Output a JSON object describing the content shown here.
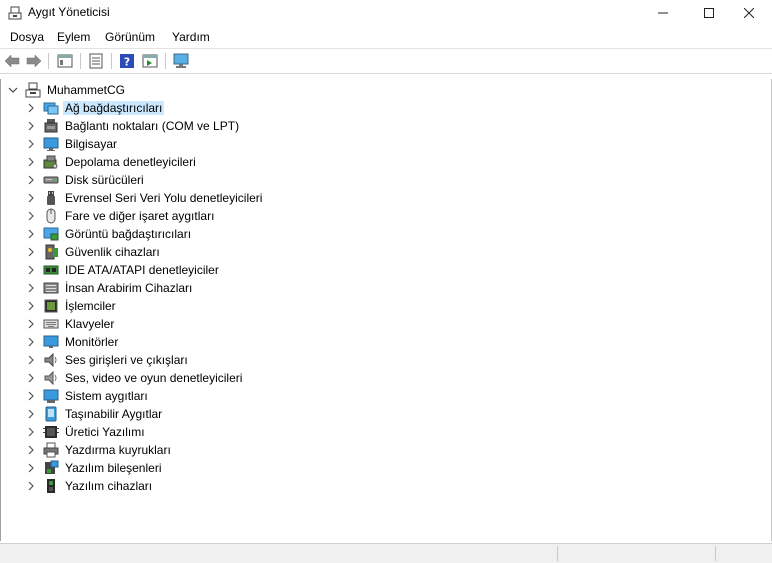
{
  "window": {
    "title": "Aygıt Yöneticisi"
  },
  "menu": [
    "Dosya",
    "Eylem",
    "Görünüm",
    "Yardım"
  ],
  "tree": {
    "root": "MuhammetCG",
    "items": [
      {
        "label": "Ağ bağdaştırıcıları",
        "icon": "network-adapter-icon",
        "selected": true
      },
      {
        "label": "Bağlantı noktaları (COM ve LPT)",
        "icon": "port-icon"
      },
      {
        "label": "Bilgisayar",
        "icon": "computer-icon"
      },
      {
        "label": "Depolama denetleyicileri",
        "icon": "storage-controller-icon"
      },
      {
        "label": "Disk sürücüleri",
        "icon": "disk-drive-icon"
      },
      {
        "label": "Evrensel Seri Veri Yolu denetleyicileri",
        "icon": "usb-icon"
      },
      {
        "label": "Fare ve diğer işaret aygıtları",
        "icon": "mouse-icon"
      },
      {
        "label": "Görüntü bağdaştırıcıları",
        "icon": "display-adapter-icon"
      },
      {
        "label": "Güvenlik cihazları",
        "icon": "security-device-icon"
      },
      {
        "label": "IDE ATA/ATAPI denetleyiciler",
        "icon": "ide-controller-icon"
      },
      {
        "label": "İnsan Arabirim Cihazları",
        "icon": "hid-icon"
      },
      {
        "label": "İşlemciler",
        "icon": "processor-icon"
      },
      {
        "label": "Klavyeler",
        "icon": "keyboard-icon"
      },
      {
        "label": "Monitörler",
        "icon": "monitor-icon"
      },
      {
        "label": "Ses girişleri ve çıkışları",
        "icon": "speaker-icon"
      },
      {
        "label": "Ses, video ve oyun denetleyicileri",
        "icon": "sound-icon"
      },
      {
        "label": "Sistem aygıtları",
        "icon": "system-device-icon"
      },
      {
        "label": "Taşınabilir Aygıtlar",
        "icon": "portable-device-icon"
      },
      {
        "label": "Üretici Yazılımı",
        "icon": "firmware-icon"
      },
      {
        "label": "Yazdırma kuyrukları",
        "icon": "printer-icon"
      },
      {
        "label": "Yazılım bileşenleri",
        "icon": "software-component-icon"
      },
      {
        "label": "Yazılım cihazları",
        "icon": "software-device-icon"
      }
    ]
  },
  "colors": {
    "selection": "#cce8ff",
    "accent": "#0078d7"
  }
}
